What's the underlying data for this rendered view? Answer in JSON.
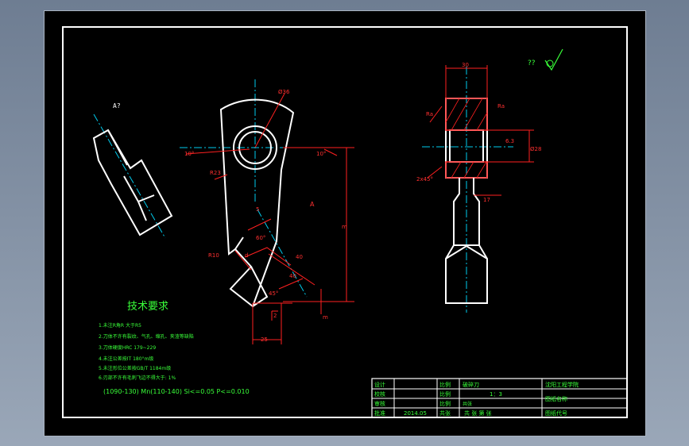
{
  "views": {
    "section_label": "A?",
    "view_arrow": "A",
    "roughness": "??"
  },
  "dims": {
    "hole_dia": "Ø36",
    "left_angle": "10°",
    "right_angle": "10°",
    "r23": "R23",
    "angle_60": "60°",
    "r10": "R10",
    "dim_45": "45°",
    "dim_25": "25",
    "dim_2": "2",
    "dim_d1": "d",
    "dim_s": "5",
    "dim_40": "40",
    "dim_40b": "40",
    "dim_m": "m",
    "dim_big": "m",
    "top_30": "30",
    "chamfer_left": "2x45°",
    "dim_right": "Ø28",
    "dim_n17": "17",
    "ra": "Ra",
    "tol_left": "Ra",
    "tol_small": "6.3"
  },
  "tech_req": {
    "title": "技术要求",
    "items": [
      "1.未注R角R 大于R5",
      "2.刀体不许有裂纹、气孔、缩孔、夹渣等缺陷",
      "3.刀体硬度HRC 179~229",
      "4.未注公差按IT 180°m级",
      "5.未注形位公差按GB/T 1184m级",
      "6.刃部不许有毛刺飞边不得大于: 1%"
    ],
    "material_line": "(1090-130) Mn(110-140) Si<=0.05 P<=0.010"
  },
  "title_block": {
    "row_labels": [
      "设计",
      "校核",
      "审核",
      "批准"
    ],
    "col_labels": [
      "比例",
      "比例",
      "比例",
      "共张"
    ],
    "drawing_name": "破碎刀",
    "school": "沈阳工程学院",
    "scale": "1：3",
    "drawing_label": "图纸名称",
    "drawing_no_label": "图纸代号",
    "sheet_text": "共    张 第    张",
    "date": "2014.05",
    "misc": "共张"
  }
}
